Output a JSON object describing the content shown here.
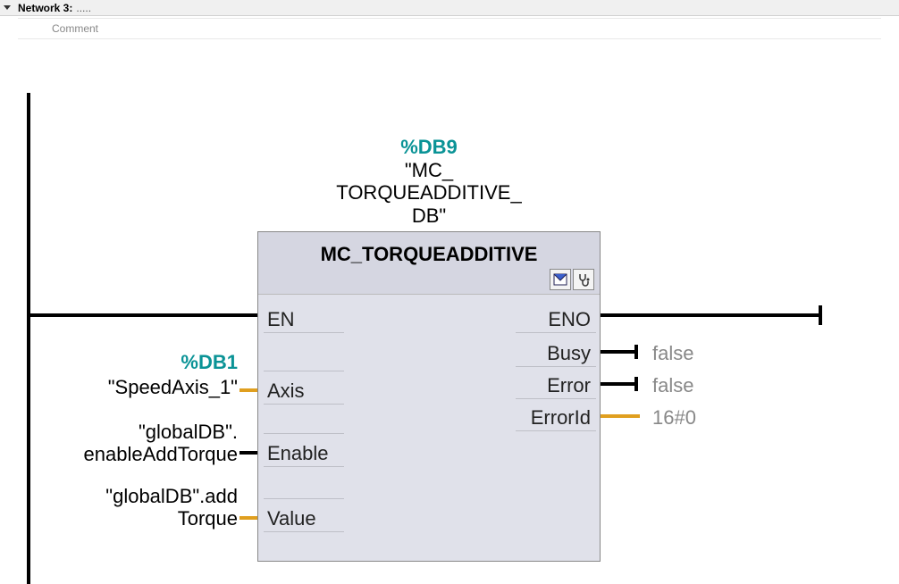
{
  "network": {
    "header_label": "Network 3:",
    "header_extra": ".....",
    "comment_placeholder": "Comment"
  },
  "instance_db": {
    "id": "%DB9",
    "name_line1": "\"MC_",
    "name_line2": "TORQUEADDITIVE_",
    "name_line3": "DB\""
  },
  "block": {
    "type_name": "MC_TORQUEADDITIVE",
    "inputs": {
      "en": "EN",
      "axis": "Axis",
      "enable": "Enable",
      "value": "Value"
    },
    "outputs": {
      "eno": "ENO",
      "busy": "Busy",
      "error": "Error",
      "errorid": "ErrorId"
    }
  },
  "operands": {
    "axis_db": "%DB1",
    "axis_name": "\"SpeedAxis_1\"",
    "enable_line1": "\"globalDB\".",
    "enable_line2": "enableAddTorque",
    "value_line1": "\"globalDB\".add",
    "value_line2": "Torque"
  },
  "out_values": {
    "busy": "false",
    "error": "false",
    "errorid": "16#0"
  },
  "icons": {
    "inbox": "inbox-icon",
    "diag": "stethoscope-icon"
  }
}
